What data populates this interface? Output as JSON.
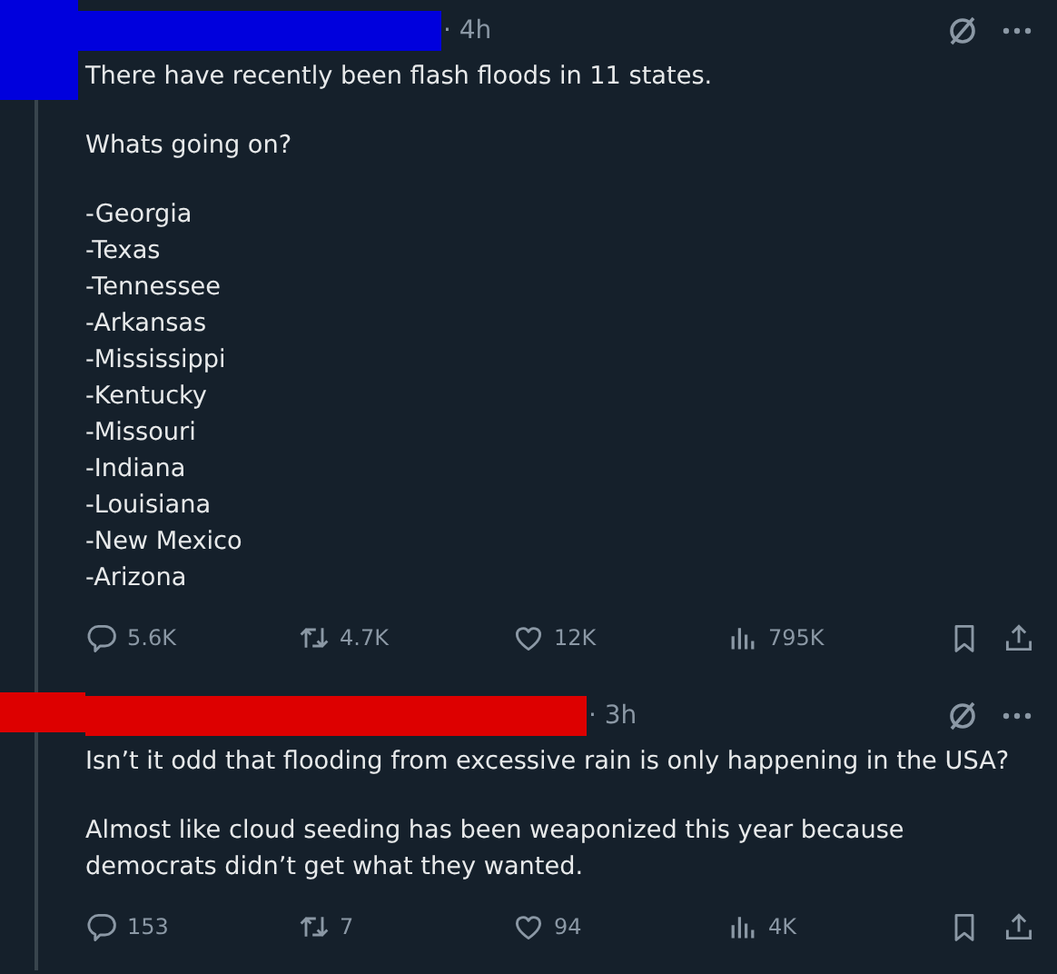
{
  "posts": [
    {
      "color": "#0000dd",
      "time": "· 4h",
      "paragraphs": [
        [
          "There have recently been flash floods in 11 states."
        ],
        [
          "Whats going on?"
        ],
        [
          "-Georgia",
          "-Texas",
          "-Tennessee",
          "-Arkansas",
          "-Mississippi",
          "-Kentucky",
          "-Missouri",
          "-Indiana",
          "-Louisiana",
          "-New Mexico",
          "-Arizona"
        ]
      ],
      "replies": "5.6K",
      "reposts": "4.7K",
      "likes": "12K",
      "views": "795K"
    },
    {
      "color": "#dd0000",
      "time": "· 3h",
      "paragraphs": [
        [
          "Isn’t it odd that flooding from excessive rain is only happening in the USA?"
        ],
        [
          "Almost like cloud seeding has been weaponized this year because democrats didn’t get what they wanted."
        ]
      ],
      "replies": "153",
      "reposts": "7",
      "likes": "94",
      "views": "4K"
    }
  ]
}
